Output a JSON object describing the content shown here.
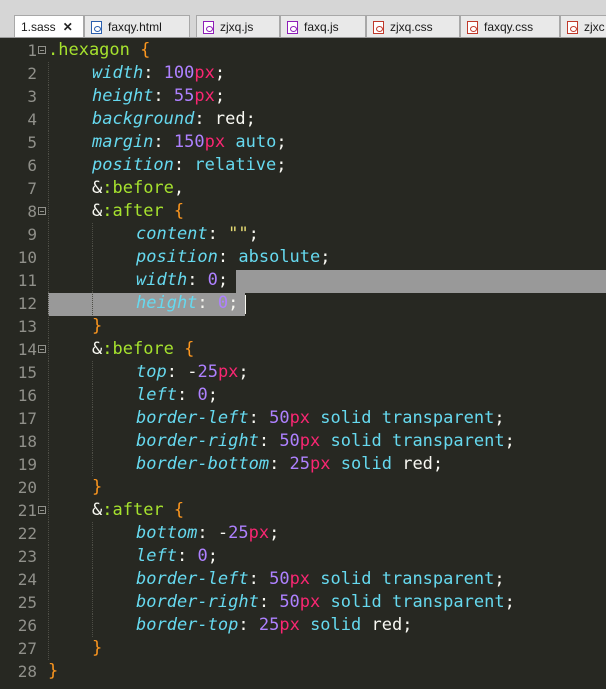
{
  "tabs": [
    {
      "label": "1.sass",
      "icon": "none",
      "active": true,
      "close": "✕"
    },
    {
      "label": "faxqy.html",
      "icon": "html-file-icon"
    },
    {
      "label": "zjxq.js",
      "icon": "js-file-icon"
    },
    {
      "label": "faxq.js",
      "icon": "js-file-icon"
    },
    {
      "label": "zjxq.css",
      "icon": "css-file-icon"
    },
    {
      "label": "faxqy.css",
      "icon": "css-file-icon"
    },
    {
      "label": "zjxc",
      "icon": "css-file-icon"
    }
  ],
  "colors": {
    "background": "#272822",
    "selector": "#a6e22e",
    "brace": "#fd971f",
    "property": "#66d9ef",
    "number": "#ae81ff",
    "unit": "#f92672",
    "string": "#e6db74",
    "selection": "#999999"
  },
  "lines": [
    {
      "n": "1",
      "fold": true,
      "tokens": [
        [
          "sel",
          ".hexagon"
        ],
        [
          "ident",
          " "
        ],
        [
          "brace",
          "{"
        ]
      ]
    },
    {
      "n": "2",
      "tokens": [
        [
          "prop",
          "width"
        ],
        [
          "punc",
          ": "
        ],
        [
          "num",
          "100"
        ],
        [
          "unit",
          "px"
        ],
        [
          "punc",
          ";"
        ]
      ]
    },
    {
      "n": "3",
      "tokens": [
        [
          "prop",
          "height"
        ],
        [
          "punc",
          ": "
        ],
        [
          "num",
          "55"
        ],
        [
          "unit",
          "px"
        ],
        [
          "punc",
          ";"
        ]
      ]
    },
    {
      "n": "4",
      "tokens": [
        [
          "prop",
          "background"
        ],
        [
          "punc",
          ": "
        ],
        [
          "ident",
          "red"
        ],
        [
          "punc",
          ";"
        ]
      ]
    },
    {
      "n": "5",
      "tokens": [
        [
          "prop",
          "margin"
        ],
        [
          "punc",
          ": "
        ],
        [
          "num",
          "150"
        ],
        [
          "unit",
          "px"
        ],
        [
          "ident",
          " "
        ],
        [
          "val",
          "auto"
        ],
        [
          "punc",
          ";"
        ]
      ]
    },
    {
      "n": "6",
      "tokens": [
        [
          "prop",
          "position"
        ],
        [
          "punc",
          ": "
        ],
        [
          "val",
          "relative"
        ],
        [
          "punc",
          ";"
        ]
      ]
    },
    {
      "n": "7",
      "tokens": [
        [
          "ident",
          "&"
        ],
        [
          "sel",
          ":before"
        ],
        [
          "punc",
          ","
        ]
      ]
    },
    {
      "n": "8",
      "fold": true,
      "tokens": [
        [
          "ident",
          "&"
        ],
        [
          "sel",
          ":after"
        ],
        [
          "ident",
          " "
        ],
        [
          "brace",
          "{"
        ]
      ]
    },
    {
      "n": "9",
      "tokens": [
        [
          "prop",
          "content"
        ],
        [
          "punc",
          ": "
        ],
        [
          "str",
          "\"\""
        ],
        [
          "punc",
          ";"
        ]
      ]
    },
    {
      "n": "10",
      "tokens": [
        [
          "prop",
          "position"
        ],
        [
          "punc",
          ": "
        ],
        [
          "val",
          "absolute"
        ],
        [
          "punc",
          ";"
        ]
      ]
    },
    {
      "n": "11",
      "tokens": [
        [
          "prop",
          "width"
        ],
        [
          "punc",
          ": "
        ],
        [
          "num",
          "0"
        ],
        [
          "punc",
          ";"
        ]
      ]
    },
    {
      "n": "12",
      "tokens": [
        [
          "prop",
          "height"
        ],
        [
          "punc",
          ": "
        ],
        [
          "num",
          "0"
        ],
        [
          "punc",
          ";"
        ]
      ]
    },
    {
      "n": "13",
      "tokens": [
        [
          "brace",
          "}"
        ]
      ]
    },
    {
      "n": "14",
      "fold": true,
      "tokens": [
        [
          "ident",
          "&"
        ],
        [
          "sel",
          ":before"
        ],
        [
          "ident",
          " "
        ],
        [
          "brace",
          "{"
        ]
      ]
    },
    {
      "n": "15",
      "tokens": [
        [
          "prop",
          "top"
        ],
        [
          "punc",
          ": "
        ],
        [
          "ident",
          "-"
        ],
        [
          "num",
          "25"
        ],
        [
          "unit",
          "px"
        ],
        [
          "punc",
          ";"
        ]
      ]
    },
    {
      "n": "16",
      "tokens": [
        [
          "prop",
          "left"
        ],
        [
          "punc",
          ": "
        ],
        [
          "num",
          "0"
        ],
        [
          "punc",
          ";"
        ]
      ]
    },
    {
      "n": "17",
      "tokens": [
        [
          "prop",
          "border-left"
        ],
        [
          "punc",
          ": "
        ],
        [
          "num",
          "50"
        ],
        [
          "unit",
          "px"
        ],
        [
          "ident",
          " "
        ],
        [
          "val",
          "solid"
        ],
        [
          "ident",
          " "
        ],
        [
          "val",
          "transparent"
        ],
        [
          "punc",
          ";"
        ]
      ]
    },
    {
      "n": "18",
      "tokens": [
        [
          "prop",
          "border-right"
        ],
        [
          "punc",
          ": "
        ],
        [
          "num",
          "50"
        ],
        [
          "unit",
          "px"
        ],
        [
          "ident",
          " "
        ],
        [
          "val",
          "solid"
        ],
        [
          "ident",
          " "
        ],
        [
          "val",
          "transparent"
        ],
        [
          "punc",
          ";"
        ]
      ]
    },
    {
      "n": "19",
      "tokens": [
        [
          "prop",
          "border-bottom"
        ],
        [
          "punc",
          ": "
        ],
        [
          "num",
          "25"
        ],
        [
          "unit",
          "px"
        ],
        [
          "ident",
          " "
        ],
        [
          "val",
          "solid"
        ],
        [
          "ident",
          " "
        ],
        [
          "ident",
          "red"
        ],
        [
          "punc",
          ";"
        ]
      ]
    },
    {
      "n": "20",
      "tokens": [
        [
          "brace",
          "}"
        ]
      ]
    },
    {
      "n": "21",
      "fold": true,
      "tokens": [
        [
          "ident",
          "&"
        ],
        [
          "sel",
          ":after"
        ],
        [
          "ident",
          " "
        ],
        [
          "brace",
          "{"
        ]
      ]
    },
    {
      "n": "22",
      "tokens": [
        [
          "prop",
          "bottom"
        ],
        [
          "punc",
          ": "
        ],
        [
          "ident",
          "-"
        ],
        [
          "num",
          "25"
        ],
        [
          "unit",
          "px"
        ],
        [
          "punc",
          ";"
        ]
      ]
    },
    {
      "n": "23",
      "tokens": [
        [
          "prop",
          "left"
        ],
        [
          "punc",
          ": "
        ],
        [
          "num",
          "0"
        ],
        [
          "punc",
          ";"
        ]
      ]
    },
    {
      "n": "24",
      "tokens": [
        [
          "prop",
          "border-left"
        ],
        [
          "punc",
          ": "
        ],
        [
          "num",
          "50"
        ],
        [
          "unit",
          "px"
        ],
        [
          "ident",
          " "
        ],
        [
          "val",
          "solid"
        ],
        [
          "ident",
          " "
        ],
        [
          "val",
          "transparent"
        ],
        [
          "punc",
          ";"
        ]
      ]
    },
    {
      "n": "25",
      "tokens": [
        [
          "prop",
          "border-right"
        ],
        [
          "punc",
          ": "
        ],
        [
          "num",
          "50"
        ],
        [
          "unit",
          "px"
        ],
        [
          "ident",
          " "
        ],
        [
          "val",
          "solid"
        ],
        [
          "ident",
          " "
        ],
        [
          "val",
          "transparent"
        ],
        [
          "punc",
          ";"
        ]
      ]
    },
    {
      "n": "26",
      "tokens": [
        [
          "prop",
          "border-top"
        ],
        [
          "punc",
          ": "
        ],
        [
          "num",
          "25"
        ],
        [
          "unit",
          "px"
        ],
        [
          "ident",
          " "
        ],
        [
          "val",
          "solid"
        ],
        [
          "ident",
          " "
        ],
        [
          "ident",
          "red"
        ],
        [
          "punc",
          ";"
        ]
      ]
    },
    {
      "n": "27",
      "tokens": [
        [
          "brace",
          "}"
        ]
      ]
    },
    {
      "n": "28",
      "tokens": [
        [
          "brace",
          "}"
        ]
      ]
    }
  ]
}
